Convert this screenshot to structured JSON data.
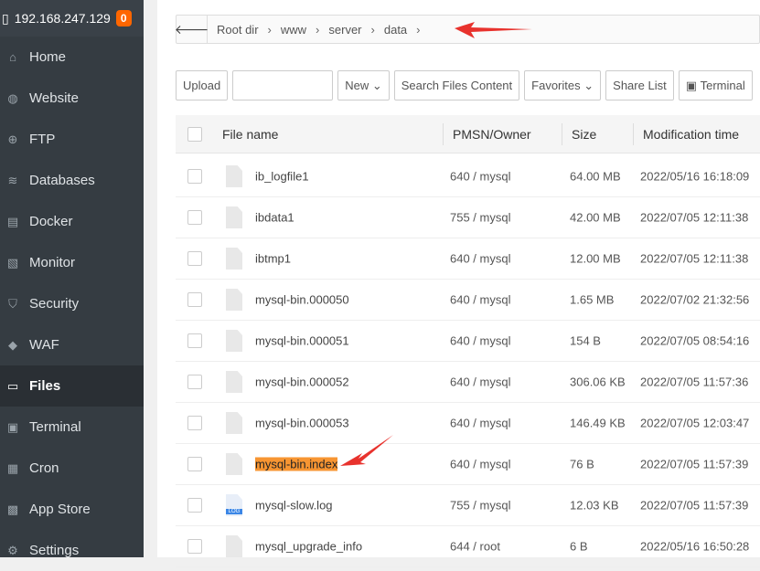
{
  "sidebar": {
    "server_ip": "192.168.247.129",
    "badge": "0",
    "items": [
      {
        "label": "Home",
        "icon": "home-icon"
      },
      {
        "label": "Website",
        "icon": "globe-icon"
      },
      {
        "label": "FTP",
        "icon": "ftp-icon"
      },
      {
        "label": "Databases",
        "icon": "database-icon"
      },
      {
        "label": "Docker",
        "icon": "docker-icon"
      },
      {
        "label": "Monitor",
        "icon": "monitor-icon"
      },
      {
        "label": "Security",
        "icon": "shield-icon"
      },
      {
        "label": "WAF",
        "icon": "waf-icon"
      },
      {
        "label": "Files",
        "icon": "folder-icon",
        "active": true
      },
      {
        "label": "Terminal",
        "icon": "terminal-icon"
      },
      {
        "label": "Cron",
        "icon": "calendar-icon"
      },
      {
        "label": "App Store",
        "icon": "apps-icon"
      },
      {
        "label": "Settings",
        "icon": "gear-icon"
      }
    ]
  },
  "breadcrumb": [
    "Root dir",
    "www",
    "server",
    "data"
  ],
  "toolbar": {
    "upload": "Upload",
    "path_input": "",
    "new": "New",
    "search": "Search Files Content",
    "favorites": "Favorites",
    "share": "Share List",
    "terminal": "Terminal"
  },
  "table": {
    "headers": {
      "name": "File name",
      "perm": "PMSN/Owner",
      "size": "Size",
      "time": "Modification time"
    },
    "rows": [
      {
        "name": "ib_logfile1",
        "perm": "640 / mysql",
        "size": "64.00 MB",
        "time": "2022/05/16 16:18:09"
      },
      {
        "name": "ibdata1",
        "perm": "755 / mysql",
        "size": "42.00 MB",
        "time": "2022/07/05 12:11:38"
      },
      {
        "name": "ibtmp1",
        "perm": "640 / mysql",
        "size": "12.00 MB",
        "time": "2022/07/05 12:11:38"
      },
      {
        "name": "mysql-bin.000050",
        "perm": "640 / mysql",
        "size": "1.65 MB",
        "time": "2022/07/02 21:32:56"
      },
      {
        "name": "mysql-bin.000051",
        "perm": "640 / mysql",
        "size": "154 B",
        "time": "2022/07/05 08:54:16"
      },
      {
        "name": "mysql-bin.000052",
        "perm": "640 / mysql",
        "size": "306.06 KB",
        "time": "2022/07/05 11:57:36"
      },
      {
        "name": "mysql-bin.000053",
        "perm": "640 / mysql",
        "size": "146.49 KB",
        "time": "2022/07/05 12:03:47"
      },
      {
        "name": "mysql-bin.index",
        "perm": "640 / mysql",
        "size": "76 B",
        "time": "2022/07/05 11:57:39",
        "highlight": true
      },
      {
        "name": "mysql-slow.log",
        "perm": "755 / mysql",
        "size": "12.03 KB",
        "time": "2022/07/05 11:57:39",
        "log": true
      },
      {
        "name": "mysql_upgrade_info",
        "perm": "644 / root",
        "size": "6 B",
        "time": "2022/05/16 16:50:28"
      }
    ]
  },
  "colors": {
    "sidebar": "#353c42",
    "badge": "#ff6600",
    "highlight": "#f79532",
    "arrow": "#e8322d"
  }
}
